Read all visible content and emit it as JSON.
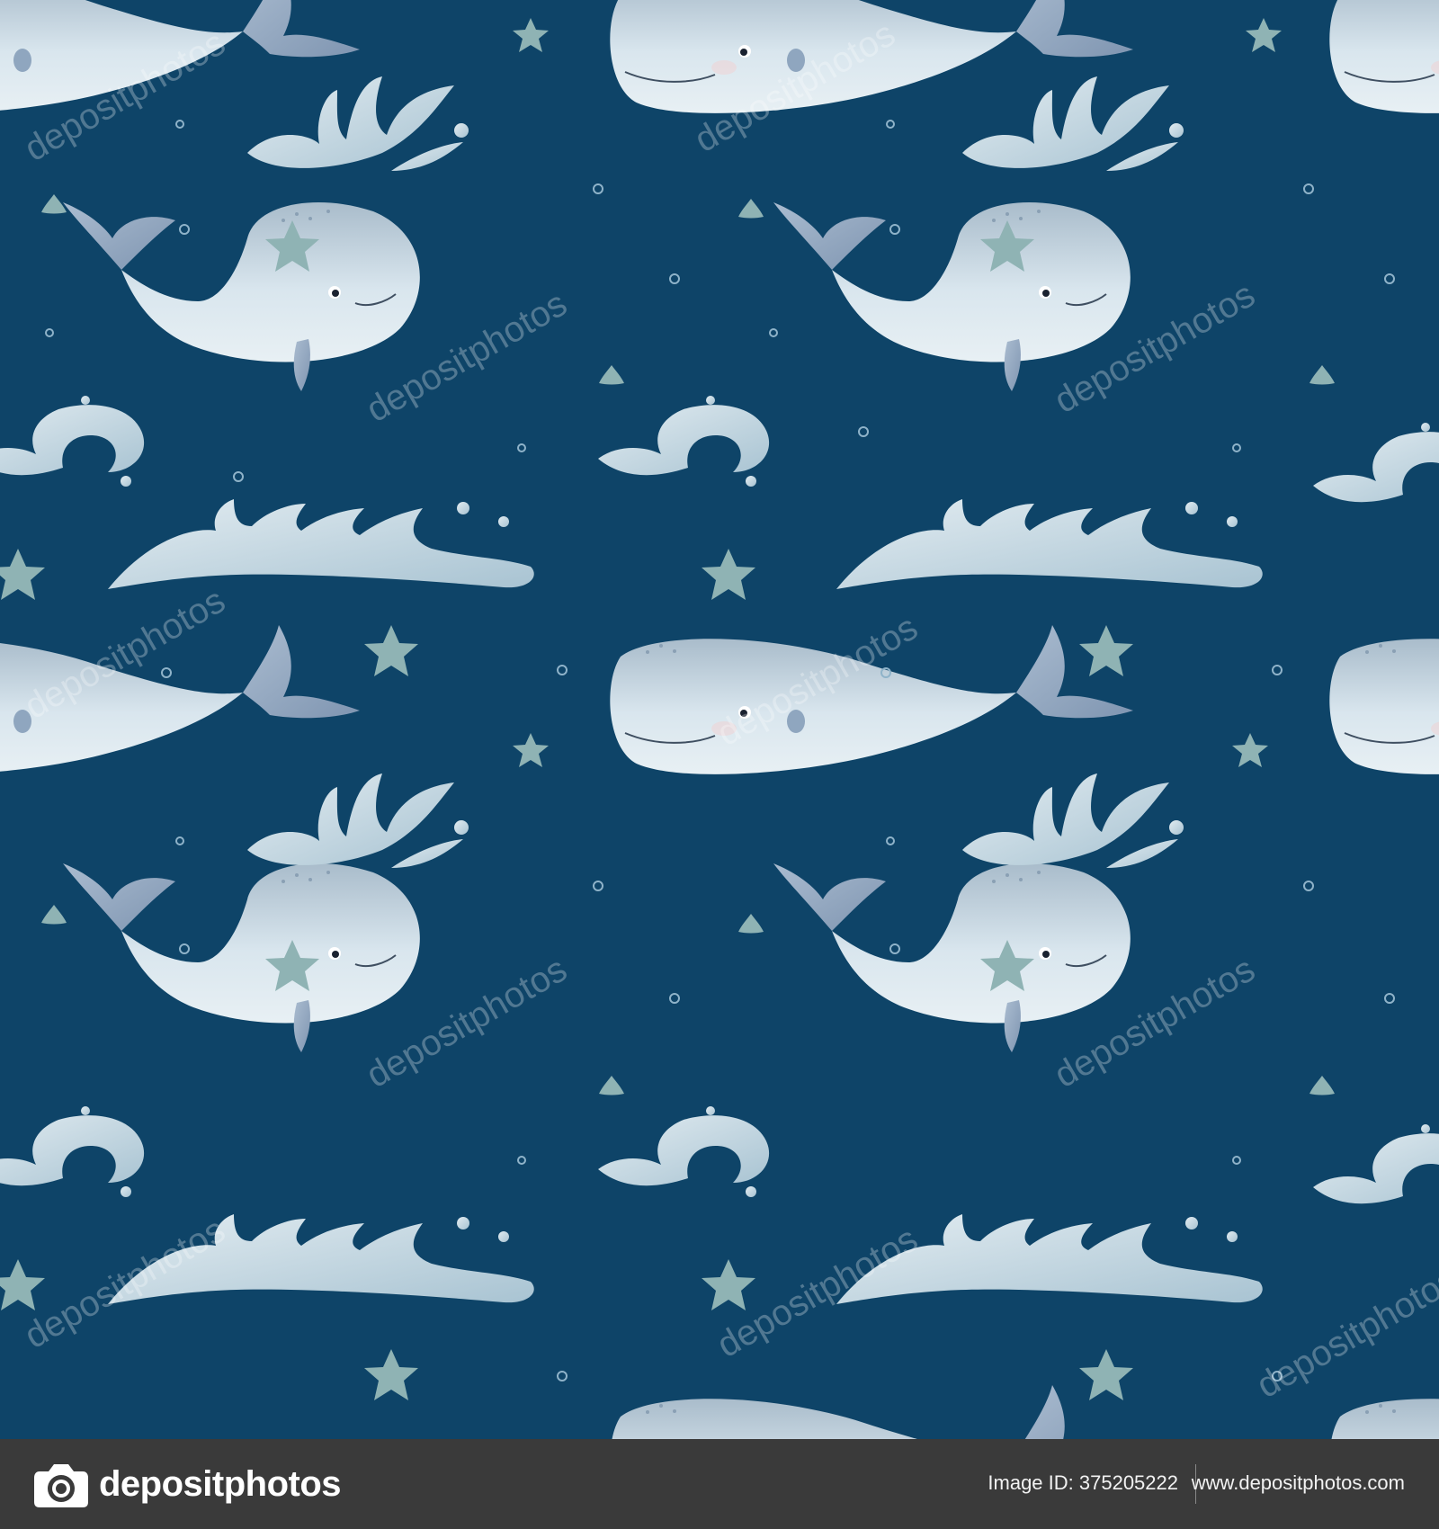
{
  "scene": {
    "background_color": "#0e4468",
    "whale_color": "#d9e6ee",
    "splash_color": "#c9dbe5",
    "star_color": "#8fb3b4",
    "subjects": [
      "whale-icon",
      "water-splash-icon",
      "starfish-icon",
      "bubble-icon"
    ]
  },
  "watermark": {
    "text": "depositphotos"
  },
  "footer": {
    "brand": "depositphotos",
    "image_id": "Image ID: 375205222",
    "site": "www.depositphotos.com",
    "background_color": "#3a3a3a"
  }
}
